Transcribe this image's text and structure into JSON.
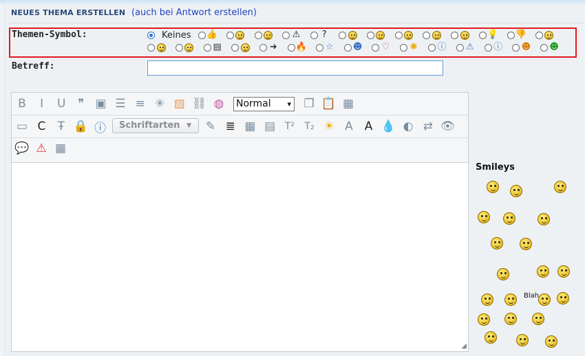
{
  "header": {
    "title": "NEUES THEMA ERSTELLEN",
    "note": "(auch bei Antwort erstellen)"
  },
  "form": {
    "icon_label": "Themen-Symbol:",
    "icon_none_label": "Keines",
    "subject_label": "Betreff:",
    "subject_value": ""
  },
  "icons_row1": [
    "thumbs-up-icon",
    "grin-icon",
    "smile-icon",
    "warning-icon",
    "question-icon",
    "angry-icon",
    "frown-icon",
    "cool-icon",
    "shocked-icon",
    "sad-icon",
    "lightbulb-icon",
    "thumbs-down-icon",
    "mad-icon"
  ],
  "icons_row2": [
    "happy-icon",
    "surprised-icon",
    "document-icon",
    "neutral-icon",
    "arrow-right-icon",
    "fire-icon",
    "star-icon",
    "blue-face-icon",
    "heart-icon",
    "sun-icon",
    "help-circle-icon",
    "warning-outline-icon",
    "info-circle-icon",
    "orange-face-icon",
    "green-face-icon"
  ],
  "editor": {
    "format_selected": "Normal",
    "font_label": "Schriftarten",
    "toolbar1": [
      "bold-icon",
      "italic-icon",
      "underline-icon",
      "quote-icon",
      "code-icon",
      "bullet-list-icon",
      "numbered-list-icon",
      "spoiler-icon",
      "image-icon",
      "link-icon",
      "color-picker-icon"
    ],
    "toolbar1b": [
      "copy-icon",
      "paste-icon",
      "paste-text-icon"
    ],
    "toolbar2": [
      "page-icon",
      "copyright-icon",
      "strikethrough-icon",
      "lock-icon",
      "info-icon"
    ],
    "toolbar2b": [
      "highlight-icon",
      "align-center-icon",
      "table-icon",
      "textbox-icon",
      "superscript-icon",
      "subscript-icon",
      "sun-effect-icon",
      "shadow-text-icon",
      "outline-text-icon",
      "drop-icon",
      "contrast-icon",
      "swap-icon",
      "preview-icon"
    ],
    "toolbar3": [
      "comment-icon",
      "alert-icon",
      "grid-icon"
    ],
    "content": ""
  },
  "smileys": {
    "title": "Smileys",
    "blah_label": "Blah"
  }
}
